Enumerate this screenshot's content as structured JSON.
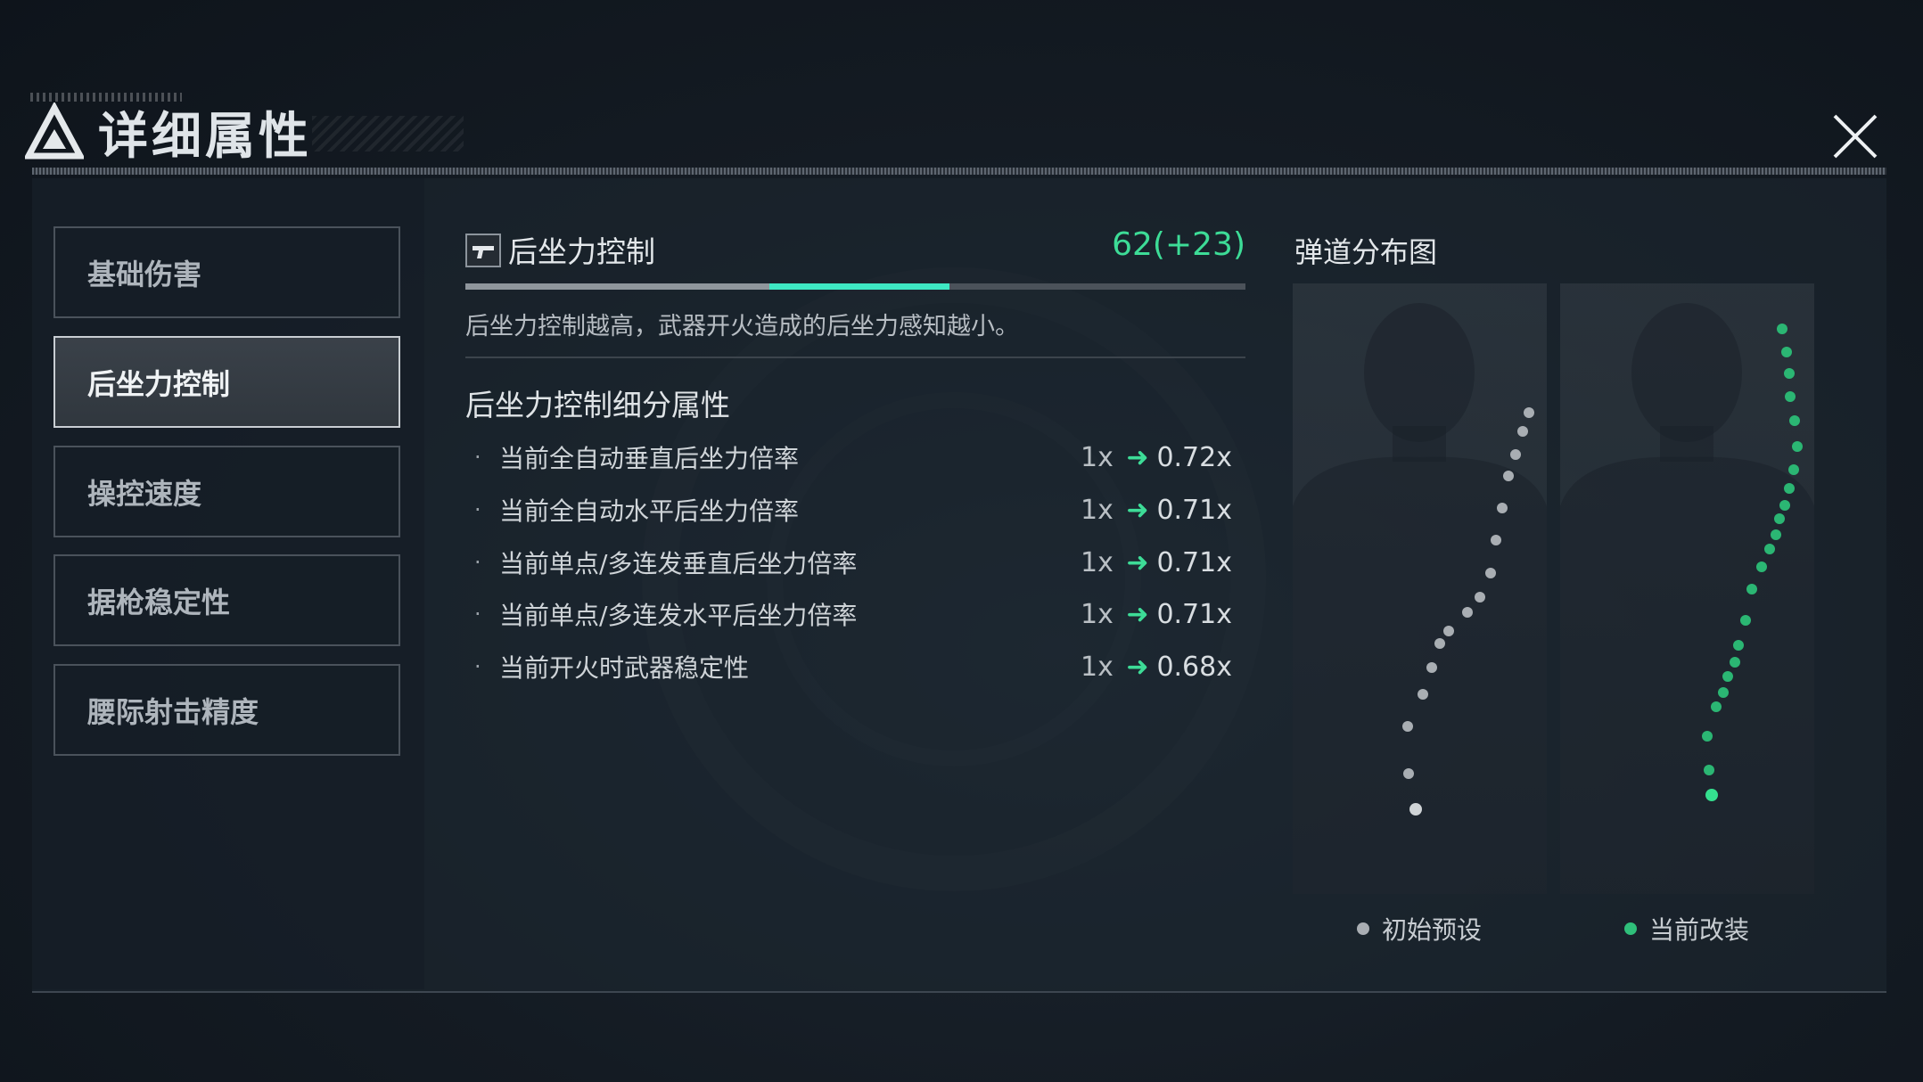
{
  "header": {
    "title": "详细属性"
  },
  "sidebar": {
    "items": [
      {
        "label": "基础伤害",
        "active": false
      },
      {
        "label": "后坐力控制",
        "active": true
      },
      {
        "label": "操控速度",
        "active": false
      },
      {
        "label": "据枪稳定性",
        "active": false
      },
      {
        "label": "腰际射击精度",
        "active": false
      }
    ]
  },
  "stat": {
    "icon": "pistol-icon",
    "name": "后坐力控制",
    "value_text": "62(+23)",
    "base_fraction": 0.39,
    "bonus_fraction": 0.23,
    "description": "后坐力控制越高，武器开火造成的后坐力感知越小。"
  },
  "sub_attributes": {
    "title": "后坐力控制细分属性",
    "items": [
      {
        "bullet": "·",
        "label": "当前全自动垂直后坐力倍率",
        "old": "1x",
        "new": "0.72x"
      },
      {
        "bullet": "·",
        "label": "当前全自动水平后坐力倍率",
        "old": "1x",
        "new": "0.71x"
      },
      {
        "bullet": "·",
        "label": "当前单点/多连发垂直后坐力倍率",
        "old": "1x",
        "new": "0.71x"
      },
      {
        "bullet": "·",
        "label": "当前单点/多连发水平后坐力倍率",
        "old": "1x",
        "new": "0.71x"
      },
      {
        "bullet": "·",
        "label": "当前开火时武器稳定性",
        "old": "1x",
        "new": "0.68x"
      }
    ]
  },
  "spread": {
    "title": "弹道分布图",
    "legend": [
      {
        "label": "初始预设",
        "color": "#a9aeb3"
      },
      {
        "label": "当前改装",
        "color": "#2fbf7a"
      }
    ]
  },
  "colors": {
    "accent": "#3ddc97",
    "bar_bonus": "#3ee8c3"
  }
}
